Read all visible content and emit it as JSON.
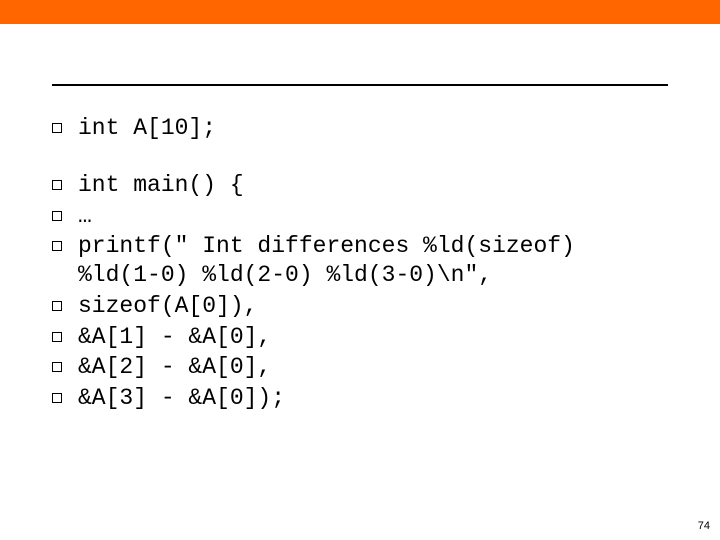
{
  "lines": [
    "int A[10];",
    "",
    "int main() {",
    "…",
    "  printf(\"      Int differences %ld(sizeof) %ld(1-0) %ld(2-0) %ld(3-0)\\n\",",
    "            sizeof(A[0]),",
    "            &A[1] - &A[0],",
    "            &A[2] - &A[0],",
    "            &A[3] - &A[0]);"
  ],
  "page_number": "74"
}
